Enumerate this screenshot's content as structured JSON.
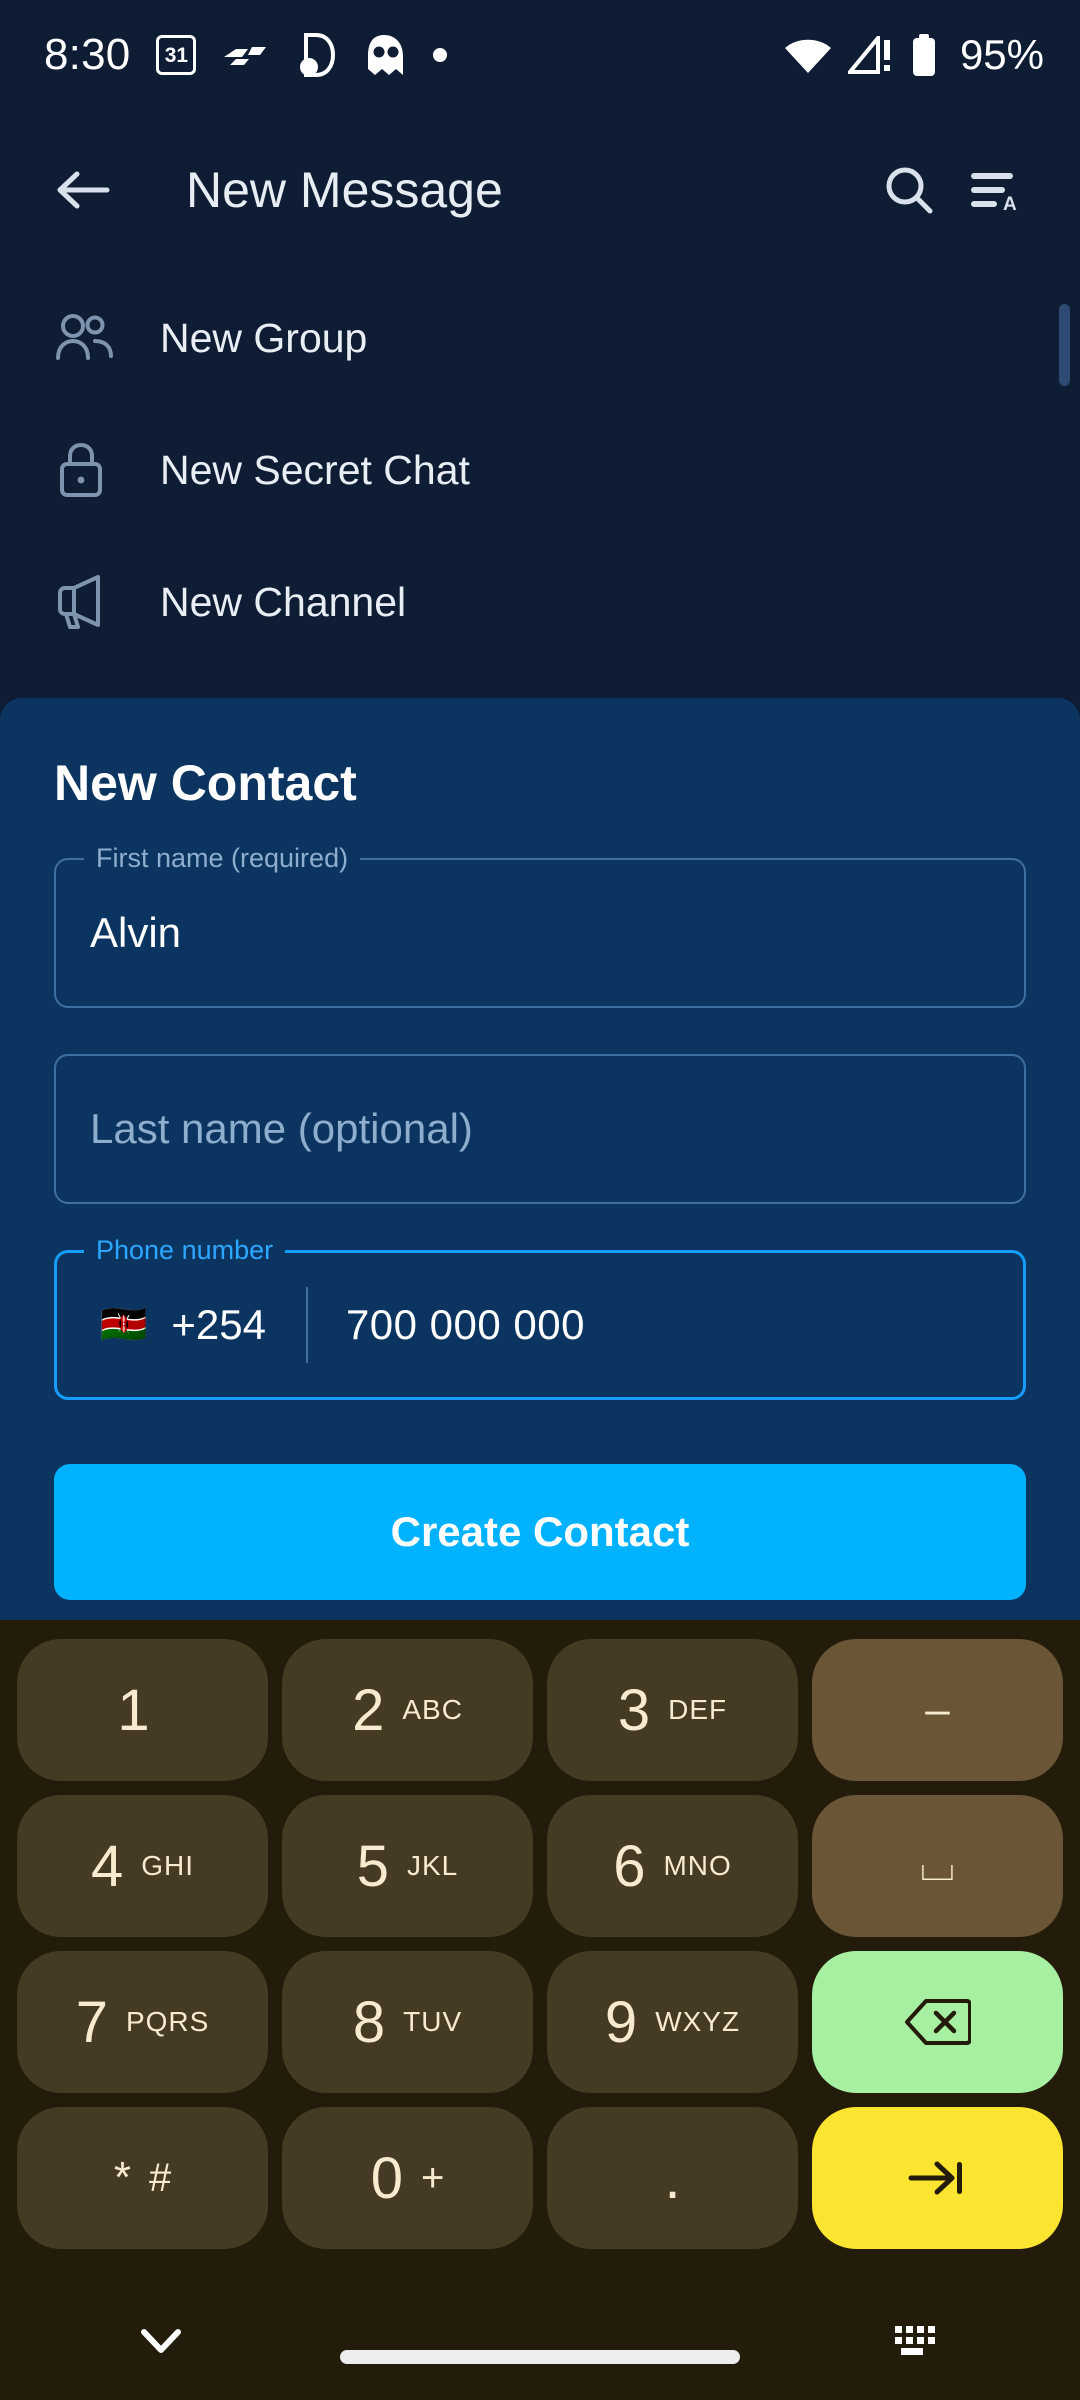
{
  "status_bar": {
    "time": "8:30",
    "calendar_day": "31",
    "battery_percent": "95%",
    "icons": [
      "calendar-31-icon",
      "f1-logo-icon",
      "app-notification-icon",
      "ghost-app-icon",
      "dot-icon",
      "wifi-icon",
      "cellular-no-service-icon",
      "battery-icon"
    ]
  },
  "app_bar": {
    "back_label": "back-arrow",
    "title": "New Message",
    "search_label": "search-icon",
    "sort_label": "sort-by-name-icon"
  },
  "list": {
    "items": [
      {
        "label": "New Group",
        "icon": "people-icon"
      },
      {
        "label": "New Secret Chat",
        "icon": "lock-icon"
      },
      {
        "label": "New Channel",
        "icon": "megaphone-icon"
      }
    ]
  },
  "dialog": {
    "title": "New Contact",
    "first_name": {
      "legend": "First name (required)",
      "value": "Alvin"
    },
    "last_name": {
      "placeholder": "Last name (optional)",
      "value": ""
    },
    "phone": {
      "legend": "Phone number",
      "flag": "🇰🇪",
      "country_code": "+254",
      "number": "700 000 000"
    },
    "submit_label": "Create Contact",
    "accent_color": "#00B2FF",
    "focus_color": "#2CA7FF",
    "card_color": "#0B3560"
  },
  "keyboard": {
    "background_color": "#241C0A",
    "key_color": "#453B24",
    "rows": [
      [
        {
          "digit": "1",
          "letters": "",
          "type": "digit"
        },
        {
          "digit": "2",
          "letters": "ABC",
          "type": "digit"
        },
        {
          "digit": "3",
          "letters": "DEF",
          "type": "digit"
        },
        {
          "digit": "–",
          "letters": "",
          "type": "fn",
          "name": "hyphen-key"
        }
      ],
      [
        {
          "digit": "4",
          "letters": "GHI",
          "type": "digit"
        },
        {
          "digit": "5",
          "letters": "JKL",
          "type": "digit"
        },
        {
          "digit": "6",
          "letters": "MNO",
          "type": "digit"
        },
        {
          "digit": "⌴",
          "letters": "",
          "type": "fn",
          "name": "space-key"
        }
      ],
      [
        {
          "digit": "7",
          "letters": "PQRS",
          "type": "digit"
        },
        {
          "digit": "8",
          "letters": "TUV",
          "type": "digit"
        },
        {
          "digit": "9",
          "letters": "WXYZ",
          "type": "digit"
        },
        {
          "digit": "",
          "letters": "",
          "type": "backspace",
          "name": "backspace-key"
        }
      ],
      [
        {
          "digit": "*",
          "letters": "#",
          "type": "digit",
          "name": "star-hash-key"
        },
        {
          "digit": "0",
          "letters": "+",
          "type": "digit"
        },
        {
          "digit": ".",
          "letters": "",
          "type": "digit",
          "name": "period-key"
        },
        {
          "digit": "",
          "letters": "",
          "type": "next",
          "name": "next-field-key"
        }
      ]
    ],
    "backspace_color": "#A7EFA1",
    "next_color": "#FBE531"
  },
  "nav_bar": {
    "hide_keyboard": "chevron-down-icon",
    "home_indicator": "home-indicator",
    "switch_keyboard": "keyboard-switch-icon"
  }
}
